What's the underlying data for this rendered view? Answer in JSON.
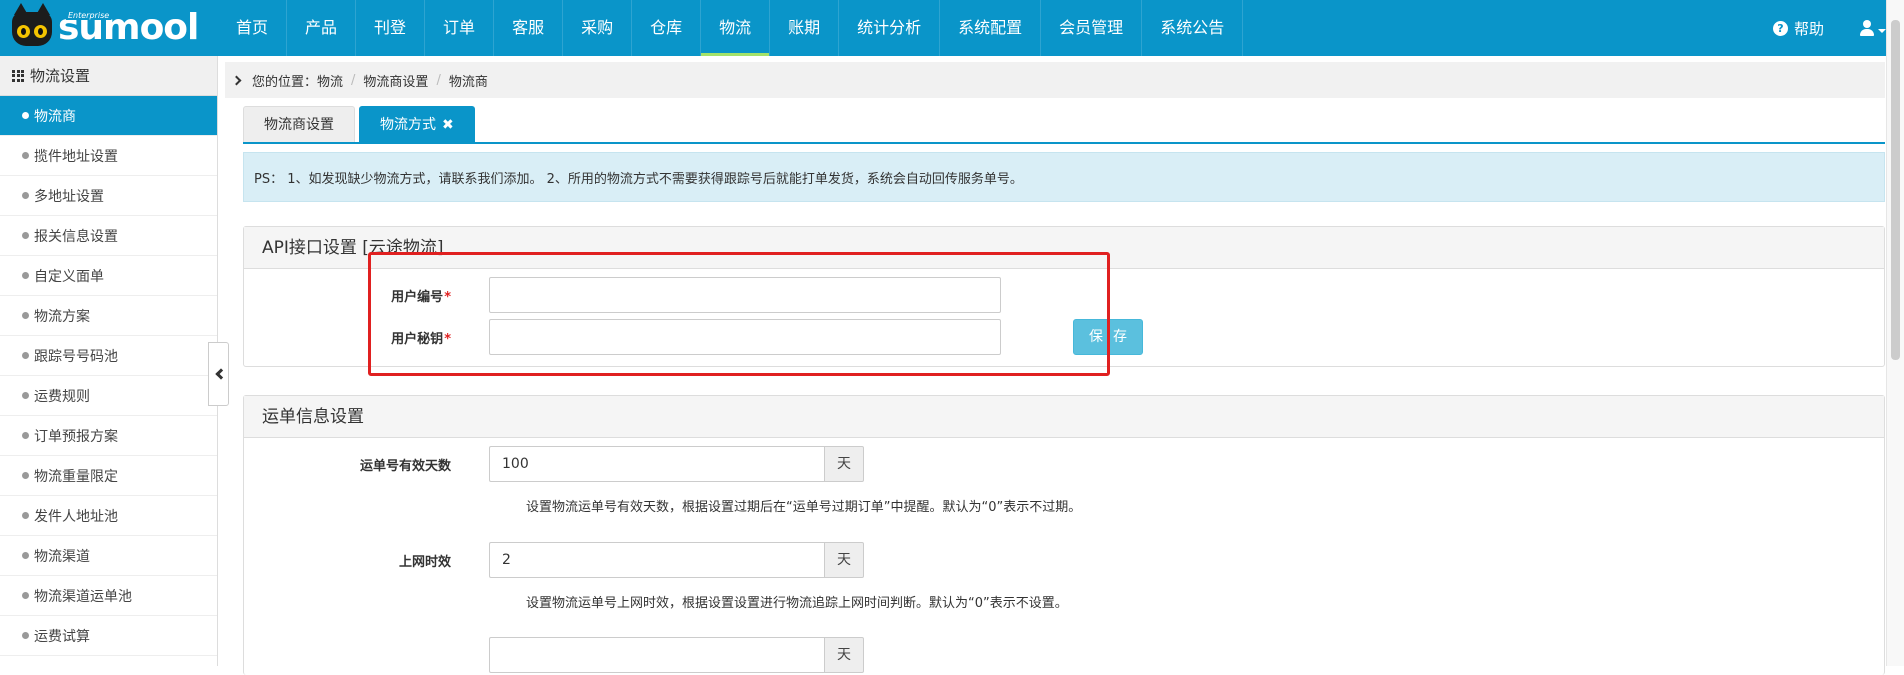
{
  "brand": {
    "name": "sumool",
    "edition": "Enterprise"
  },
  "nav": {
    "items": [
      "首页",
      "产品",
      "刊登",
      "订单",
      "客服",
      "采购",
      "仓库",
      "物流",
      "账期",
      "统计分析",
      "系统配置",
      "会员管理",
      "系统公告"
    ],
    "active_index": 7,
    "help_label": "帮助"
  },
  "sidebar": {
    "title": "物流设置",
    "items": [
      "物流商",
      "揽件地址设置",
      "多地址设置",
      "报关信息设置",
      "自定义面单",
      "物流方案",
      "跟踪号号码池",
      "运费规则",
      "订单预报方案",
      "物流重量限定",
      "发件人地址池",
      "物流渠道",
      "物流渠道运单池",
      "运费试算"
    ],
    "active_index": 0
  },
  "breadcrumb": {
    "prefix": "您的位置：",
    "items": [
      "物流",
      "物流商设置",
      "物流商"
    ]
  },
  "tabs": {
    "items": [
      "物流商设置",
      "物流方式"
    ],
    "active_index": 1,
    "close_glyph": "✖"
  },
  "notice": "PS： 1、如发现缺少物流方式，请联系我们添加。 2、所用的物流方式不需要获得跟踪号后就能打单发货，系统会自动回传服务单号。",
  "api_panel": {
    "title": "API接口设置 [云途物流]",
    "user_id_label": "用户编号",
    "user_id_value": "",
    "user_secret_label": "用户秘钥",
    "user_secret_value": "",
    "save_label": "保存"
  },
  "waybill_panel": {
    "title": "运单信息设置",
    "valid_days_label": "运单号有效天数",
    "valid_days_value": "100",
    "valid_days_unit": "天",
    "valid_days_help": "设置物流运单号有效天数，根据设置过期后在“运单号过期订单”中提醒。默认为“0”表示不过期。",
    "online_label": "上网时效",
    "online_value": "2",
    "online_unit": "天",
    "online_help": "设置物流运单号上网时效，根据设置设置进行物流追踪上网时间判断。默认为“0”表示不设置。",
    "third_unit": "天"
  },
  "colors": {
    "accent": "#0a95c9",
    "annotation": "#e02020",
    "nav_active_underline": "#a3e26a"
  }
}
